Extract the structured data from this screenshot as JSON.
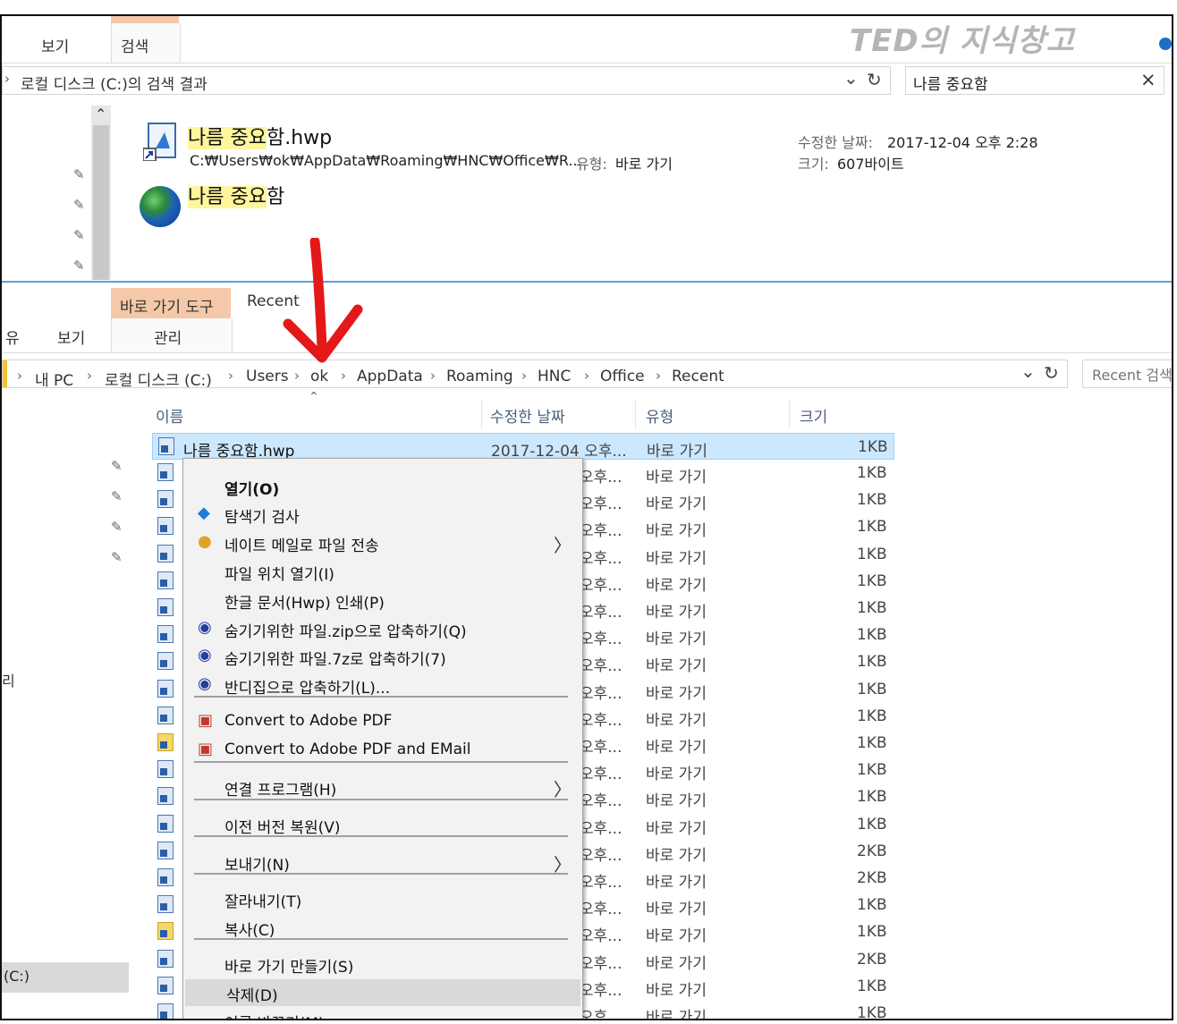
{
  "watermark": "TED의 지식창고",
  "top_window": {
    "tabs": [
      "보기",
      "검색"
    ],
    "address": "로컬 디스크 (C:)의 검색 결과",
    "search_value": "나름 중요함",
    "results": [
      {
        "name_highlight": "나름 중요",
        "name_rest": "함.hwp",
        "path": "C:₩Users₩ok₩AppData₩Roaming₩HNC₩Office₩R...",
        "type_label": "유형:",
        "type_value": "바로 가기",
        "date_label": "수정한 날짜:",
        "date_value": "2017-12-04 오후 2:28",
        "size_label": "크기:",
        "size_value": "607바이트"
      },
      {
        "name_highlight": "나름 중요",
        "name_rest": "함"
      }
    ]
  },
  "bottom_window": {
    "ribbon": {
      "context_tab": "바로 가기 도구",
      "recent_tab": "Recent",
      "sub_tabs": [
        "유",
        "보기",
        "관리"
      ]
    },
    "breadcrumb": [
      "내 PC",
      "로컬 디스크 (C:)",
      "Users",
      "ok",
      "AppData",
      "Roaming",
      "HNC",
      "Office",
      "Recent"
    ],
    "search_placeholder": "Recent 검색",
    "columns": [
      "이름",
      "수정한 날짜",
      "유형",
      "크기"
    ],
    "selected_row": {
      "name": "나름 중요함.hwp",
      "date": "2017-12-04 오후...",
      "type": "바로 가기",
      "size": "1KB"
    },
    "rows": [
      {
        "date": "오후...",
        "type": "바로 가기",
        "size": "1KB"
      },
      {
        "date": "오후...",
        "type": "바로 가기",
        "size": "1KB"
      },
      {
        "date": "오후...",
        "type": "바로 가기",
        "size": "1KB"
      },
      {
        "date": "오후...",
        "type": "바로 가기",
        "size": "1KB"
      },
      {
        "date": "오후...",
        "type": "바로 가기",
        "size": "1KB"
      },
      {
        "date": "오후...",
        "type": "바로 가기",
        "size": "1KB"
      },
      {
        "date": "오후...",
        "type": "바로 가기",
        "size": "1KB"
      },
      {
        "date": "오후...",
        "type": "바로 가기",
        "size": "1KB"
      },
      {
        "date": "오후...",
        "type": "바로 가기",
        "size": "1KB"
      },
      {
        "date": "오후...",
        "type": "바로 가기",
        "size": "1KB"
      },
      {
        "date": "오후...",
        "type": "바로 가기",
        "size": "1KB"
      },
      {
        "date": "오후...",
        "type": "바로 가기",
        "size": "1KB"
      },
      {
        "date": "오후...",
        "type": "바로 가기",
        "size": "1KB"
      },
      {
        "date": "오후...",
        "type": "바로 가기",
        "size": "1KB"
      },
      {
        "date": "오후...",
        "type": "바로 가기",
        "size": "2KB"
      },
      {
        "date": "오후...",
        "type": "바로 가기",
        "size": "2KB"
      },
      {
        "date": "오후...",
        "type": "바로 가기",
        "size": "1KB"
      },
      {
        "date": "오후...",
        "type": "바로 가기",
        "size": "1KB"
      },
      {
        "date": "오후...",
        "type": "바로 가기",
        "size": "2KB"
      },
      {
        "date": "오후...",
        "type": "바로 가기",
        "size": "1KB"
      },
      {
        "date": "오후...",
        "type": "바로 가기",
        "size": "1KB"
      }
    ],
    "nav_label_left": "리",
    "nav_drive": "(C:)"
  },
  "context_menu": {
    "items": [
      {
        "label": "열기(O)",
        "bold": true
      },
      {
        "label": "탐색기 검사"
      },
      {
        "label": "네이트 메일로 파일 전송",
        "submenu": true
      },
      {
        "label": "파일 위치 열기(I)"
      },
      {
        "label": "한글 문서(Hwp) 인쇄(P)"
      },
      {
        "label": "숨기기위한 파일.zip으로 압축하기(Q)"
      },
      {
        "label": "숨기기위한 파일.7z로 압축하기(7)"
      },
      {
        "label": "반디집으로 압축하기(L)..."
      },
      {
        "label": "Convert to Adobe PDF"
      },
      {
        "label": "Convert to Adobe PDF and EMail"
      },
      {
        "label": "연결 프로그램(H)",
        "submenu": true
      },
      {
        "label": "이전 버전 복원(V)"
      },
      {
        "label": "보내기(N)",
        "submenu": true
      },
      {
        "label": "잘라내기(T)"
      },
      {
        "label": "복사(C)"
      },
      {
        "label": "바로 가기 만들기(S)"
      },
      {
        "label": "삭제(D)"
      },
      {
        "label": "이름 바꾸기(M)"
      }
    ],
    "submenu_glyph": "〉"
  },
  "icons": {
    "refresh": "↻",
    "dropdown": "⌄",
    "close": "×",
    "collapse": "⌃",
    "pin": "📌",
    "breadcrumb_sep": "›",
    "arrow_down": "↓"
  },
  "colors": {
    "highlight": "#fff59d",
    "context_tab": "#f4c8a8",
    "selection": "#cce8ff",
    "arrow": "#e41818"
  }
}
